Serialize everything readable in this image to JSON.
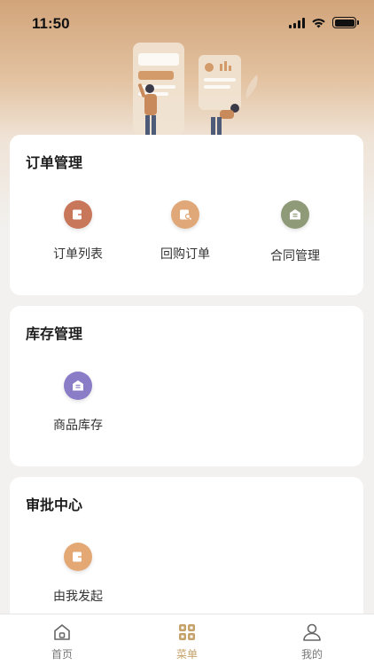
{
  "status_bar": {
    "time": "11:50"
  },
  "sections": [
    {
      "title": "订单管理",
      "items": [
        {
          "label": "订单列表",
          "icon": "document-arrow-icon",
          "color": "#c9775b"
        },
        {
          "label": "回购订单",
          "icon": "document-search-icon",
          "color": "#e0a878"
        },
        {
          "label": "合同管理",
          "icon": "envelope-icon",
          "color": "#8f9a78"
        }
      ]
    },
    {
      "title": "库存管理",
      "items": [
        {
          "label": "商品库存",
          "icon": "envelope-icon",
          "color": "#8b7cc8"
        }
      ]
    },
    {
      "title": "审批中心",
      "items": [
        {
          "label": "由我发起",
          "icon": "document-arrow-icon",
          "color": "#e3a874"
        }
      ]
    }
  ],
  "tabbar": {
    "home": "首页",
    "menu": "菜单",
    "mine": "我的",
    "active_color": "#c6a26a"
  }
}
